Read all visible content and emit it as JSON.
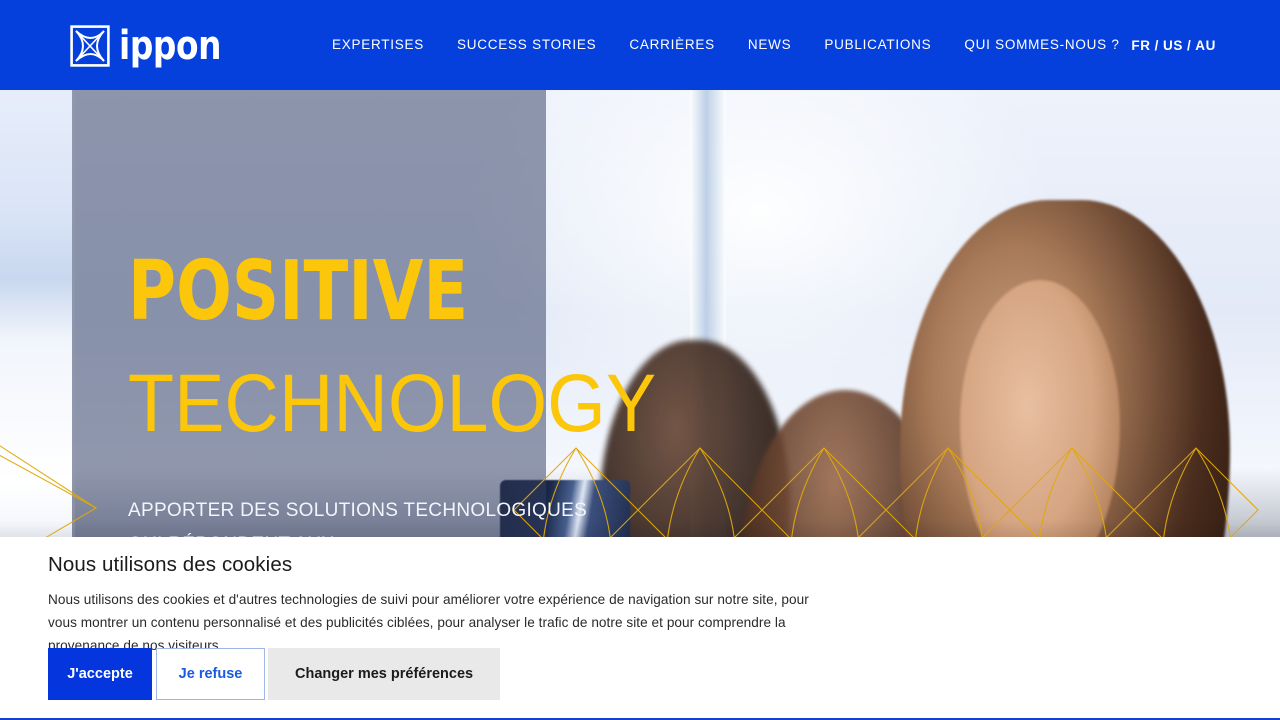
{
  "header": {
    "logo": {
      "mark_icon": "ippon-square-arcs-icon",
      "wordmark": "ippon"
    },
    "nav": [
      {
        "label": "EXPERTISES",
        "name": "nav-item-expertises"
      },
      {
        "label": "SUCCESS STORIES",
        "name": "nav-item-success-stories"
      },
      {
        "label": "CARRIÈRES",
        "name": "nav-item-carrieres"
      },
      {
        "label": "NEWS",
        "name": "nav-item-news"
      },
      {
        "label": "PUBLICATIONS",
        "name": "nav-item-publications"
      },
      {
        "label": "QUI SOMMES-NOUS ?",
        "name": "nav-item-qui-sommes-nous"
      }
    ],
    "languages": {
      "fr": "FR",
      "us": "US",
      "au": "AU",
      "separator": "/"
    },
    "background_color": "#0540dc"
  },
  "hero": {
    "headline_line1": "POSITIVE",
    "headline_line2": "TECHNOLOGY",
    "subheadline": "APPORTER DES SOLUTIONS TECHNOLOGIQUES QUI RÉPONDENT AUX",
    "headline_color": "#fcc60b",
    "overlay_color": "rgba(52,64,100,0.52)",
    "pattern_color": "#e0a90b",
    "image_description": "Photo of three smiling colleagues, one holding a dark ippon mug, bright office window background"
  },
  "cookie_banner": {
    "title": "Nous utilisons des cookies",
    "body": "Nous utilisons des cookies et d'autres technologies de suivi pour améliorer votre expérience de navigation sur notre site, pour vous montrer un contenu personnalisé et des publicités ciblées, pour analyser le trafic de notre site et pour comprendre la provenance de nos visiteurs.",
    "accept_label": "J'accepte",
    "refuse_label": "Je refuse",
    "preferences_label": "Changer mes préférences",
    "accept_color": "#0535dc",
    "refuse_text_color": "#1a5ae0",
    "preferences_bg": "#e9e9e9"
  }
}
